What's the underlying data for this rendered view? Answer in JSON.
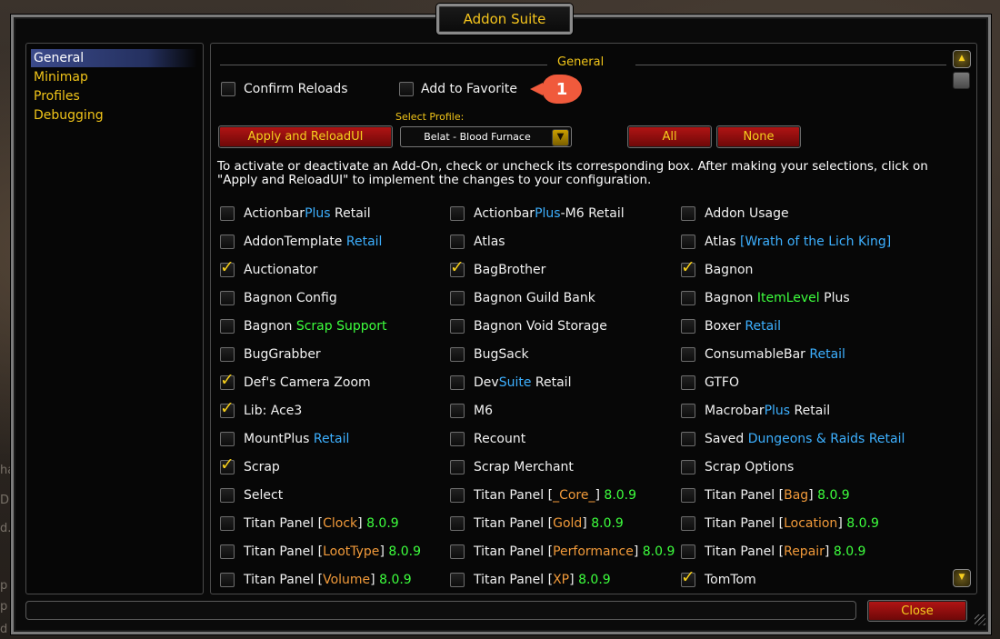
{
  "window": {
    "title": "Addon Suite"
  },
  "background_text": [
    "hanged",
    "D S[?:",
    "d. type /",
    "p",
    "p",
    "d"
  ],
  "sidebar": {
    "items": [
      {
        "label": "General",
        "active": true
      },
      {
        "label": "Minimap",
        "active": false
      },
      {
        "label": "Profiles",
        "active": false
      },
      {
        "label": "Debugging",
        "active": false
      }
    ]
  },
  "header": {
    "title": "General"
  },
  "options": {
    "confirm_reloads": {
      "label": "Confirm Reloads",
      "checked": false
    },
    "add_to_favorite": {
      "label": "Add to Favorite",
      "checked": false
    }
  },
  "annotation": {
    "badge": "1"
  },
  "buttons": {
    "apply": "Apply and ReloadUI",
    "all": "All",
    "none": "None",
    "close": "Close"
  },
  "profile": {
    "label": "Select Profile:",
    "selected": "Belat - Blood Furnace"
  },
  "instructions": "To activate or deactivate an Add-On, check or uncheck its corresponding box. After making your selections, click on \"Apply and ReloadUI\" to implement the changes to your configuration.",
  "colors": {
    "gold": "#f0c419",
    "blue": "#3db0ff",
    "green": "#3dff3d",
    "orange": "#f19a3a",
    "button_red": "#b01414",
    "badge": "#f05a3c"
  },
  "addons": [
    [
      {
        "text": "ActionbarPlus Retail",
        "checked": false,
        "parts": [
          [
            "ActionbarPlus ",
            ""
          ],
          [
            "Plus",
            "blue"
          ],
          [
            " Retail",
            ""
          ]
        ]
      },
      {
        "text": "AddonTemplate Retail",
        "checked": false
      },
      {
        "text": "Auctionator",
        "checked": true
      },
      {
        "text": "Bagnon Config",
        "checked": false
      },
      {
        "text": "Bagnon Scrap Support",
        "checked": false
      },
      {
        "text": "BugGrabber",
        "checked": false
      },
      {
        "text": "Def's Camera Zoom",
        "checked": true
      },
      {
        "text": "Lib: Ace3",
        "checked": true
      },
      {
        "text": "MountPlus Retail",
        "checked": false
      },
      {
        "text": "Scrap",
        "checked": true
      },
      {
        "text": "Select",
        "checked": false
      },
      {
        "text": "Titan Panel [Clock] 8.0.9",
        "checked": false
      },
      {
        "text": "Titan Panel [LootType] 8.0.9",
        "checked": false
      },
      {
        "text": "Titan Panel [Volume] 8.0.9",
        "checked": false
      }
    ],
    [
      {
        "text": "ActionbarPlus-M6 Retail",
        "checked": false
      },
      {
        "text": "Atlas",
        "checked": false
      },
      {
        "text": "BagBrother",
        "checked": true
      },
      {
        "text": "Bagnon Guild Bank",
        "checked": false
      },
      {
        "text": "Bagnon Void Storage",
        "checked": false
      },
      {
        "text": "BugSack",
        "checked": false
      },
      {
        "text": "DevSuite Retail",
        "checked": false
      },
      {
        "text": "M6",
        "checked": false
      },
      {
        "text": "Recount",
        "checked": false
      },
      {
        "text": "Scrap Merchant",
        "checked": false
      },
      {
        "text": "Titan Panel [_Core_] 8.0.9",
        "checked": false
      },
      {
        "text": "Titan Panel [Gold] 8.0.9",
        "checked": false
      },
      {
        "text": "Titan Panel [Performance] 8.0.9",
        "checked": false
      },
      {
        "text": "Titan Panel [XP] 8.0.9",
        "checked": false
      }
    ],
    [
      {
        "text": "Addon Usage",
        "checked": false
      },
      {
        "text": "Atlas [Wrath of the Lich King]",
        "checked": false
      },
      {
        "text": "Bagnon",
        "checked": true
      },
      {
        "text": "Bagnon ItemLevel Plus",
        "checked": false
      },
      {
        "text": "Boxer Retail",
        "checked": false
      },
      {
        "text": "ConsumableBar Retail",
        "checked": false
      },
      {
        "text": "GTFO",
        "checked": false
      },
      {
        "text": "MacrobarPlus Retail",
        "checked": false
      },
      {
        "text": "Saved Dungeons & Raids Retail",
        "checked": false
      },
      {
        "text": "Scrap Options",
        "checked": false
      },
      {
        "text": "Titan Panel [Bag] 8.0.9",
        "checked": false
      },
      {
        "text": "Titan Panel [Location] 8.0.9",
        "checked": false
      },
      {
        "text": "Titan Panel [Repair] 8.0.9",
        "checked": false
      },
      {
        "text": "TomTom",
        "checked": true
      }
    ]
  ],
  "icons": {
    "scroll_up": "scroll-up-arrow-icon",
    "scroll_down": "scroll-down-arrow-icon",
    "dropdown": "chevron-down-icon",
    "resize": "resize-grip-icon"
  }
}
